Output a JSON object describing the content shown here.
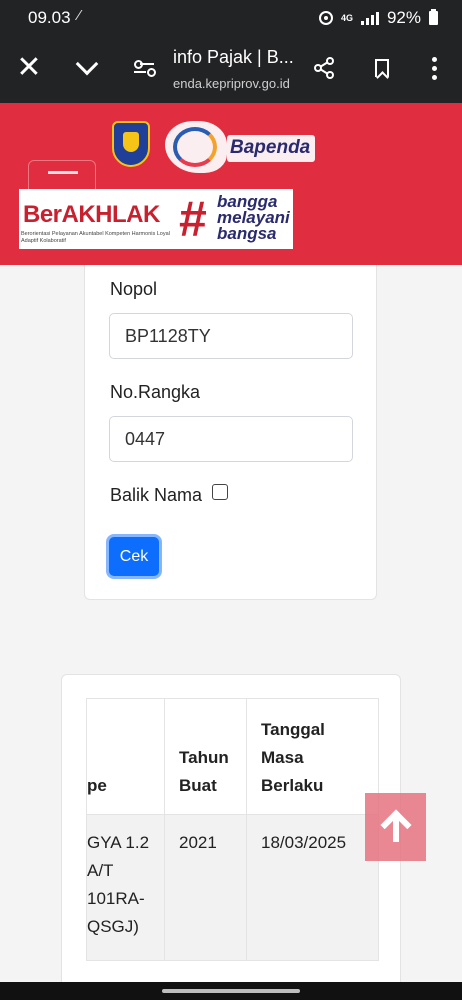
{
  "status_bar": {
    "time": "09.03",
    "network": "4G",
    "battery": "92%"
  },
  "browser": {
    "title": "info Pajak | B...",
    "url": "enda.kepriprov.go.id"
  },
  "header": {
    "brand_name": "Bapenda",
    "berakhlak_word": "BerAKHLAK",
    "berakhlak_tagline": "Berorientasi Pelayanan Akuntabel Kompeten Harmonis Loyal Adaptif Kolaboratif",
    "berakhlak_hash": "#",
    "slogan_line1": "bangga",
    "slogan_line2": "melayani",
    "slogan_line3": "bangsa"
  },
  "form": {
    "nopol_label": "Nopol",
    "nopol_value": "BP1128TY",
    "rangka_label": "No.Rangka",
    "rangka_value": "0447",
    "balik_nama_label": "Balik Nama",
    "balik_nama_checked": false,
    "submit_label": "Cek"
  },
  "result_table": {
    "headers": [
      "pe",
      "Tahun Buat",
      "Tanggal Masa Berlaku"
    ],
    "rows": [
      {
        "tipe": "GYA 1.2 A/T 101RA- QSGJ)",
        "tahun_buat": "2021",
        "tanggal_masa_berlaku": "18/03/2025"
      }
    ]
  },
  "colors": {
    "header_red": "#e02d3f",
    "primary_button": "#0d6efd",
    "scroll_top_button": "#e57380"
  },
  "icons": [
    "close-icon",
    "chevron-down-icon",
    "tune-icon",
    "share-icon",
    "bookmark-icon",
    "more-vert-icon",
    "menu-icon",
    "arrow-up-icon"
  ]
}
